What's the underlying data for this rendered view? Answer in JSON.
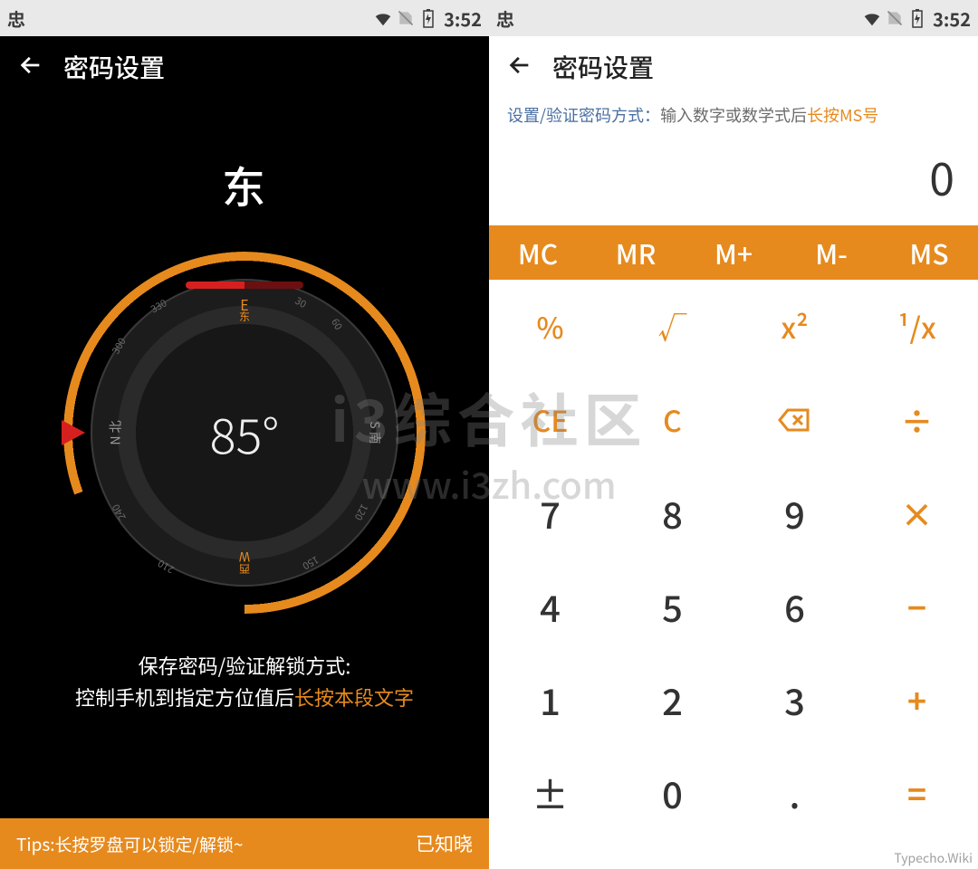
{
  "status": {
    "glyph": "忠",
    "time": "3:52"
  },
  "left": {
    "title": "密码设置",
    "direction": "东",
    "degree": "85°",
    "cardinals": {
      "e": "E",
      "e_sub": "东",
      "s": "S",
      "w": "W",
      "w_sub": "西",
      "n": "N 北"
    },
    "ticks": {
      "t30": "30",
      "t60": "60",
      "t120": "120",
      "t150": "150",
      "t210": "210",
      "t240": "240",
      "t300": "300",
      "t330": "330"
    },
    "instruct_line1": "保存密码/验证解锁方式:",
    "instruct_line2a": "控制手机到指定方位值后",
    "instruct_line2b": "长按本段文字",
    "tip": "Tips:长按罗盘可以锁定/解锁~",
    "tip_done": "已知晓"
  },
  "right": {
    "title": "密码设置",
    "hint_a": "设置/验证密码方式：",
    "hint_b": "输入数字或数学式后",
    "hint_c": "长按MS号",
    "display": "0",
    "mem": [
      "MC",
      "MR",
      "M+",
      "M-",
      "MS"
    ],
    "row1": [
      "%",
      "√",
      "x²",
      "¹/x"
    ],
    "row2": [
      "CE",
      "C",
      "⌫",
      "÷"
    ],
    "row3": [
      "7",
      "8",
      "9",
      "×"
    ],
    "row4": [
      "4",
      "5",
      "6",
      "−"
    ],
    "row5": [
      "1",
      "2",
      "3",
      "+"
    ],
    "row6": [
      "±",
      "0",
      ".",
      "="
    ]
  },
  "watermark": {
    "big": "i3综合社区",
    "url": "www.i3zh.com",
    "small": "Typecho.Wiki"
  }
}
